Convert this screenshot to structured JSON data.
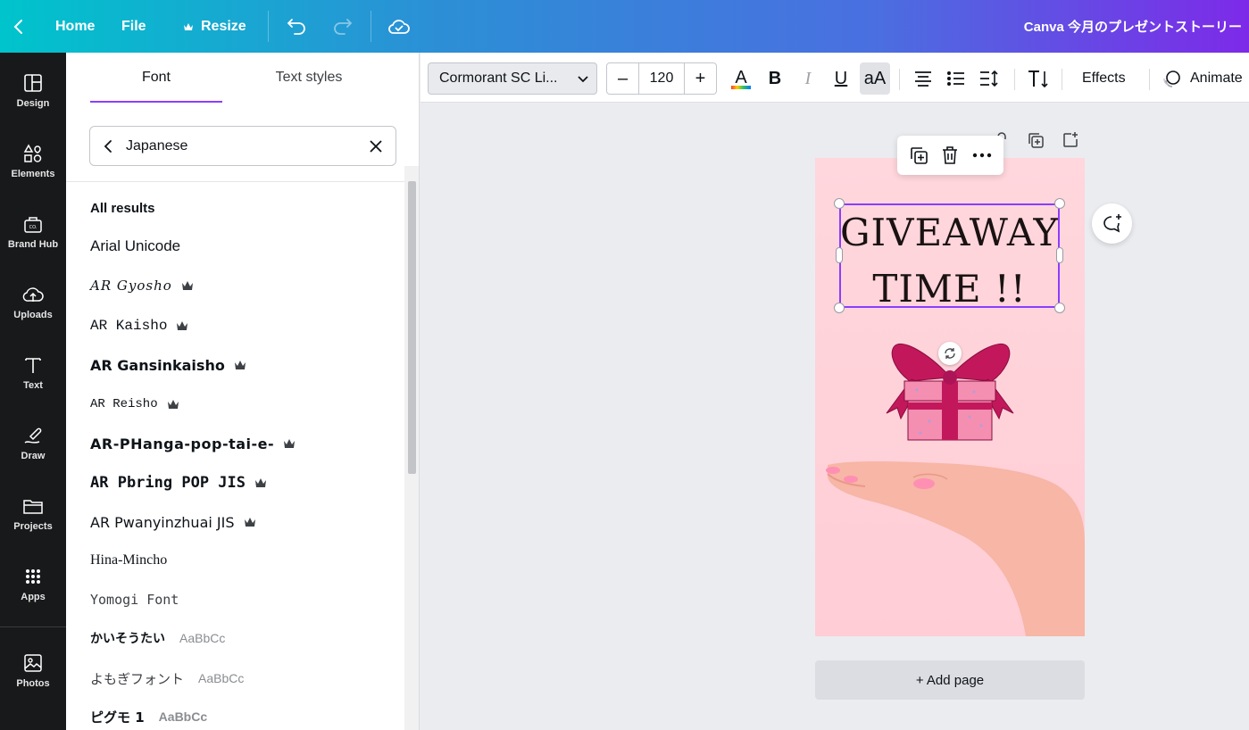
{
  "topbar": {
    "home_label": "Home",
    "file_label": "File",
    "resize_label": "Resize",
    "design_title": "Canva 今月のプレゼントストーリー"
  },
  "rail": [
    {
      "label": "Design",
      "icon": "design-icon"
    },
    {
      "label": "Elements",
      "icon": "elements-icon"
    },
    {
      "label": "Brand Hub",
      "icon": "brand-hub-icon"
    },
    {
      "label": "Uploads",
      "icon": "uploads-icon"
    },
    {
      "label": "Text",
      "icon": "text-icon"
    },
    {
      "label": "Draw",
      "icon": "draw-icon"
    },
    {
      "label": "Projects",
      "icon": "projects-icon"
    },
    {
      "label": "Apps",
      "icon": "apps-icon"
    },
    {
      "label": "Photos",
      "icon": "photos-icon"
    }
  ],
  "panel": {
    "tabs": [
      {
        "label": "Font"
      },
      {
        "label": "Text styles"
      }
    ],
    "active_tab": "Font",
    "search_value": "Japanese",
    "results_heading": "All results",
    "fonts": [
      {
        "name": "Arial Unicode",
        "premium": false,
        "sample": ""
      },
      {
        "name": "AR Gyosho",
        "premium": true,
        "sample": ""
      },
      {
        "name": "AR Kaisho",
        "premium": true,
        "sample": ""
      },
      {
        "name": "AR Gansinkaisho",
        "premium": true,
        "sample": ""
      },
      {
        "name": "AR Reisho",
        "premium": true,
        "sample": ""
      },
      {
        "name": "AR-PHanga-pop-tai-e-",
        "premium": true,
        "sample": ""
      },
      {
        "name": "AR Pbring POP JIS",
        "premium": true,
        "sample": ""
      },
      {
        "name": "AR Pwanyinzhuai JIS",
        "premium": true,
        "sample": ""
      },
      {
        "name": "Hina-Mincho",
        "premium": false,
        "sample": ""
      },
      {
        "name": "Yomogi Font",
        "premium": false,
        "sample": ""
      },
      {
        "name": "かいそうたい",
        "premium": false,
        "sample": "AaBbCc"
      },
      {
        "name": "よもぎフォント",
        "premium": false,
        "sample": "AaBbCc"
      },
      {
        "name": "ピグモ 1",
        "premium": false,
        "sample": "AaBbCc"
      }
    ]
  },
  "toolbar": {
    "font_name": "Cormorant SC Li...",
    "font_size": "120",
    "decrease_label": "–",
    "increase_label": "+",
    "bold_label": "B",
    "italic_label": "I",
    "underline_label": "U",
    "case_label": "aA",
    "effects_label": "Effects",
    "animate_label": "Animate"
  },
  "canvas": {
    "text_line1": "GIVEAWAY",
    "text_line2": "TIME !!",
    "add_page_label": "+ Add page"
  },
  "colors": {
    "accent": "#8b3dff",
    "rail_bg": "#18191b",
    "page_bg": "#ffd7dd",
    "ribbon": "#c2185b",
    "gift_box": "#f48fb1"
  }
}
